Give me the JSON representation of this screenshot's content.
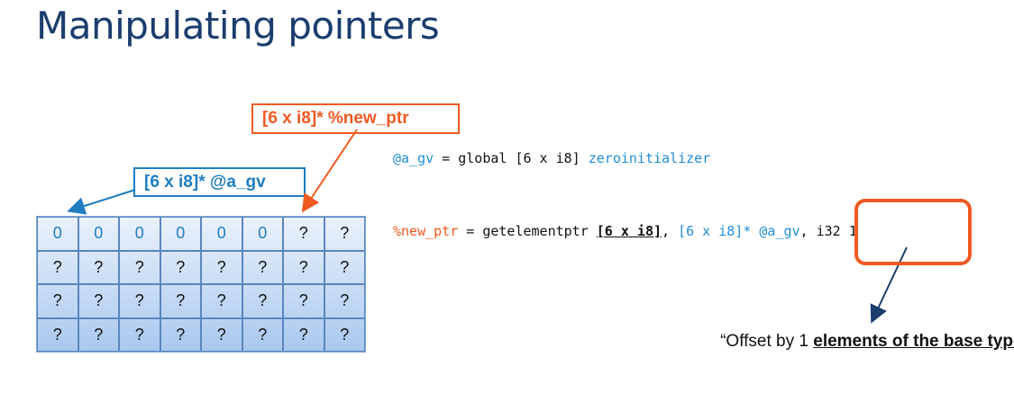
{
  "title": "Manipulating pointers",
  "labels": {
    "new_ptr": "[6 x i8]* %new_ptr",
    "a_gv": "[6 x i8]* @a_gv"
  },
  "grid": {
    "rows": [
      [
        "0",
        "0",
        "0",
        "0",
        "0",
        "0",
        "?",
        "?"
      ],
      [
        "?",
        "?",
        "?",
        "?",
        "?",
        "?",
        "?",
        "?"
      ],
      [
        "?",
        "?",
        "?",
        "?",
        "?",
        "?",
        "?",
        "?"
      ],
      [
        "?",
        "?",
        "?",
        "?",
        "?",
        "?",
        "?",
        "?"
      ]
    ]
  },
  "code": {
    "line1": {
      "var": "@a_gv",
      "mid": " = global [6 x i8] ",
      "init": "zeroinitializer"
    },
    "line2": {
      "var": "%new_ptr",
      "mid": " = getelementptr ",
      "base_type": "[6 x i8]",
      "comma": ", ",
      "ptr": "[6 x i8]* @a_gv",
      "rest": ", i32 1"
    }
  },
  "note": {
    "prefix": "“Offset by 1 ",
    "emph": "elements of the base type",
    "suffix": "”"
  },
  "colors": {
    "title": "#1b3d6e",
    "orange": "#f05a22",
    "blue": "#1f7dc0"
  }
}
